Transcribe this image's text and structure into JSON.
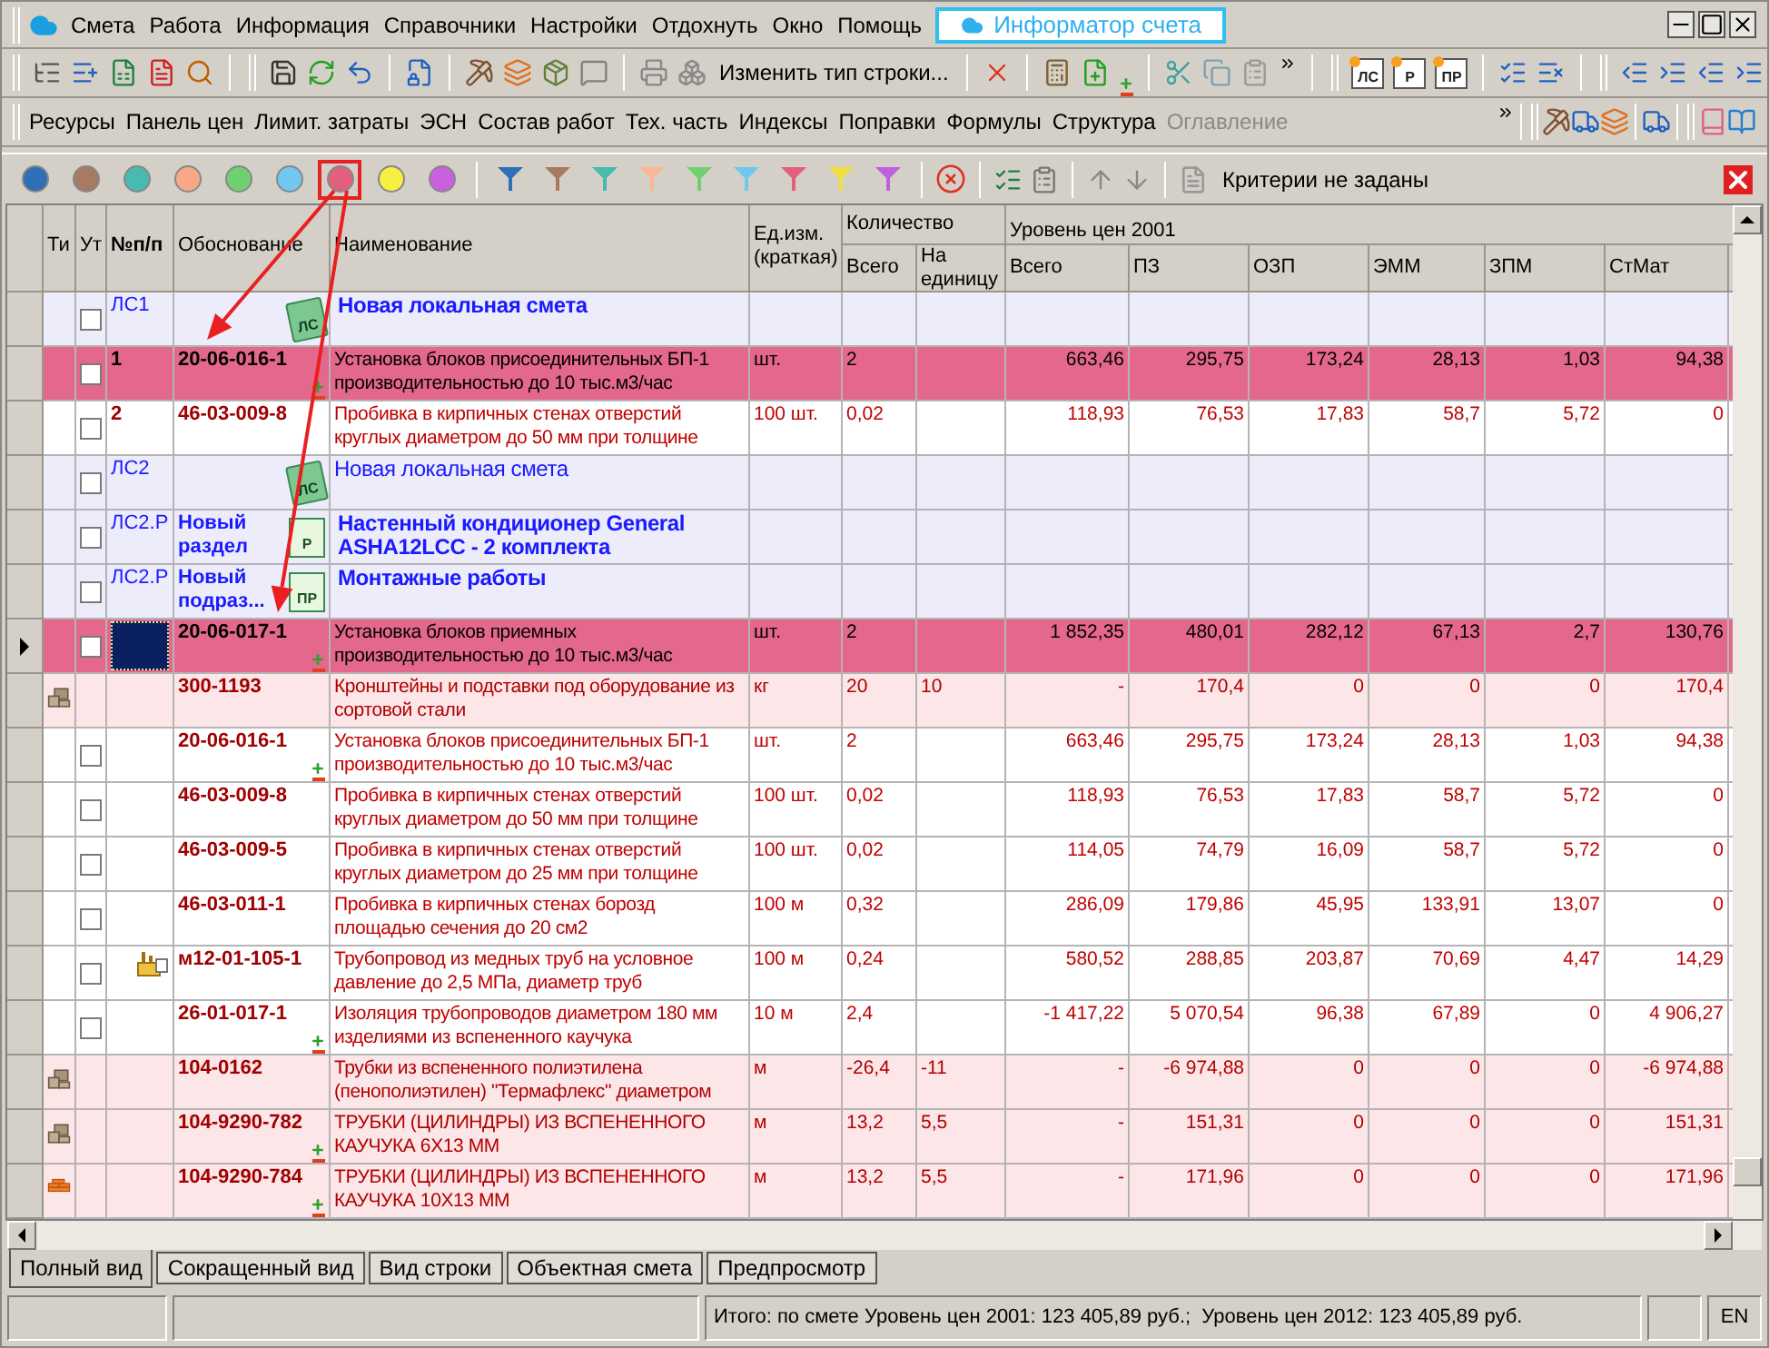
{
  "menu": {
    "items": [
      "Смета",
      "Работа",
      "Информация",
      "Справочники",
      "Настройки",
      "Отдохнуть",
      "Окно",
      "Помощь"
    ],
    "app_tab": "Информатор счета"
  },
  "toolbar": {
    "change_type_button": "Изменить тип строки...",
    "structure_buttons": [
      "ЛС",
      "Р",
      "ПР"
    ]
  },
  "panels": [
    {
      "label": "Ресурсы",
      "disabled": false
    },
    {
      "label": "Панель цен",
      "disabled": false
    },
    {
      "label": "Лимит. затраты",
      "disabled": false
    },
    {
      "label": "ЭСН",
      "disabled": false
    },
    {
      "label": "Состав работ",
      "disabled": false
    },
    {
      "label": "Тех. часть",
      "disabled": false
    },
    {
      "label": "Индексы",
      "disabled": false
    },
    {
      "label": "Поправки",
      "disabled": false
    },
    {
      "label": "Формулы",
      "disabled": false
    },
    {
      "label": "Структура",
      "disabled": false
    },
    {
      "label": "Оглавление",
      "disabled": true
    }
  ],
  "filters": {
    "dots": [
      {
        "color": "#2f6fb8",
        "selected": false
      },
      {
        "color": "#a87a64",
        "selected": false
      },
      {
        "color": "#48bab0",
        "selected": false
      },
      {
        "color": "#f8a888",
        "selected": false
      },
      {
        "color": "#70d070",
        "selected": false
      },
      {
        "color": "#70c8f0",
        "selected": false
      },
      {
        "color": "#e0607e",
        "selected": true
      },
      {
        "color": "#f8f040",
        "selected": false
      },
      {
        "color": "#c860e0",
        "selected": false
      }
    ],
    "funnels": [
      {
        "color": "#2f6fb8"
      },
      {
        "color": "#a87a64"
      },
      {
        "color": "#48bab0"
      },
      {
        "color": "#f8b898"
      },
      {
        "color": "#70d070"
      },
      {
        "color": "#70c8f0"
      },
      {
        "color": "#e0607e"
      },
      {
        "color": "#f0e040"
      },
      {
        "color": "#c060e0"
      }
    ],
    "criteria": "Критерии не заданы"
  },
  "table": {
    "columns": {
      "type": "Ти",
      "deleted": "Ут",
      "number": "№п/п",
      "basis": "Обоснование",
      "name": "Наименование",
      "unit": "Ед.изм. (краткая)",
      "quantity": "Количество",
      "total": "Всего",
      "per_unit": "На единицу",
      "price_level": "Уровень цен 2001",
      "prices": [
        "Всего",
        "ПЗ",
        "ОЗП",
        "ЭММ",
        "ЗПМ",
        "СтМат"
      ]
    },
    "rows": [
      {
        "kind": "section",
        "num": "ЛС1",
        "code": "",
        "name": "Новая локальная смета",
        "bold": true,
        "icon_label": "ЛС",
        "checked": false
      },
      {
        "kind": "position",
        "highlighted": true,
        "current": false,
        "num": "1",
        "code": "20-06-016-1",
        "adjustable": true,
        "name": "Установка блоков присоединительных БП-1 производительностью до 10 тыс.м3/час",
        "unit": "шт.",
        "qty": "2",
        "per_unit": "",
        "values": [
          "663,46",
          "295,75",
          "173,24",
          "28,13",
          "1,03",
          "94,38"
        ],
        "checked": false
      },
      {
        "kind": "position",
        "highlighted": false,
        "current": false,
        "num": "2",
        "code": "46-03-009-8",
        "adjustable": false,
        "name": "Пробивка в кирпичных стенах отверстий круглых диаметром до 50 мм при толщине",
        "unit": "100 шт.",
        "qty": "0,02",
        "per_unit": "",
        "values": [
          "118,93",
          "76,53",
          "17,83",
          "58,7",
          "5,72",
          "0"
        ],
        "checked": false
      },
      {
        "kind": "section",
        "num": "ЛС2",
        "code": "",
        "name": "Новая локальная смета",
        "bold": false,
        "icon_label": "ЛС",
        "checked": false
      },
      {
        "kind": "section",
        "num": "ЛС2.Р",
        "code": "Новый раздел",
        "name": "Настенный кондиционер General ASHA12LCC - 2 комплекта",
        "bold": true,
        "icon_label": "Р",
        "checked": false
      },
      {
        "kind": "section",
        "num": "ЛС2.Р",
        "code": "Новый подраз...",
        "name": "Монтажные работы",
        "bold": true,
        "icon_label": "ПР",
        "checked": false
      },
      {
        "kind": "position",
        "highlighted": true,
        "current": true,
        "num": "",
        "code": "20-06-017-1",
        "adjustable": true,
        "name": "Установка блоков приемных производительностью до 10 тыс.м3/час",
        "unit": "шт.",
        "qty": "2",
        "per_unit": "",
        "values": [
          "1 852,35",
          "480,01",
          "282,12",
          "67,13",
          "2,7",
          "130,76"
        ],
        "checked": false
      },
      {
        "kind": "equipment",
        "code": "300-1193",
        "adjustable": false,
        "name": "Кронштейны и подставки под оборудование из сортовой стали",
        "unit": "кг",
        "qty": "20",
        "per_unit": "10",
        "values": [
          "-",
          "170,4",
          "0",
          "0",
          "0",
          "170,4"
        ]
      },
      {
        "kind": "position",
        "highlighted": false,
        "current": false,
        "num": "",
        "code": "20-06-016-1",
        "adjustable": true,
        "name": "Установка блоков присоединительных БП-1 производительностью до 10 тыс.м3/час",
        "unit": "шт.",
        "qty": "2",
        "per_unit": "",
        "values": [
          "663,46",
          "295,75",
          "173,24",
          "28,13",
          "1,03",
          "94,38"
        ],
        "checked": false
      },
      {
        "kind": "position",
        "highlighted": false,
        "current": false,
        "num": "",
        "code": "46-03-009-8",
        "adjustable": false,
        "name": "Пробивка в кирпичных стенах отверстий круглых диаметром до 50 мм при толщине",
        "unit": "100 шт.",
        "qty": "0,02",
        "per_unit": "",
        "values": [
          "118,93",
          "76,53",
          "17,83",
          "58,7",
          "5,72",
          "0"
        ],
        "checked": false
      },
      {
        "kind": "position",
        "highlighted": false,
        "current": false,
        "num": "",
        "code": "46-03-009-5",
        "adjustable": false,
        "name": "Пробивка в кирпичных стенах отверстий круглых диаметром до 25 мм при толщине",
        "unit": "100 шт.",
        "qty": "0,02",
        "per_unit": "",
        "values": [
          "114,05",
          "74,79",
          "16,09",
          "58,7",
          "5,72",
          "0"
        ],
        "checked": false
      },
      {
        "kind": "position",
        "highlighted": false,
        "current": false,
        "num": "",
        "code": "46-03-011-1",
        "adjustable": false,
        "name": "Пробивка в кирпичных стенах борозд площадью сечения до 20 см2",
        "unit": "100 м",
        "qty": "0,32",
        "per_unit": "",
        "values": [
          "286,09",
          "179,86",
          "45,95",
          "133,91",
          "13,07",
          "0"
        ],
        "checked": false
      },
      {
        "kind": "installation",
        "highlighted": false,
        "current": false,
        "num": "",
        "code": "м12-01-105-1",
        "adjustable": false,
        "name": "Трубопровод из медных труб на условное давление до 2,5 МПа, диаметр труб",
        "unit": "100 м",
        "qty": "0,24",
        "per_unit": "",
        "values": [
          "580,52",
          "288,85",
          "203,87",
          "70,69",
          "4,47",
          "14,29"
        ],
        "checked": false
      },
      {
        "kind": "position",
        "highlighted": false,
        "current": false,
        "num": "",
        "code": "26-01-017-1",
        "adjustable": true,
        "name": "Изоляция трубопроводов диаметром 180 мм изделиями из вспененного каучука",
        "unit": "10 м",
        "qty": "2,4",
        "per_unit": "",
        "values": [
          "-1 417,22",
          "5 070,54",
          "96,38",
          "67,89",
          "0",
          "4 906,27"
        ],
        "checked": false
      },
      {
        "kind": "equipment",
        "code": "104-0162",
        "adjustable": false,
        "name": "Трубки из вспененного полиэтилена (пенополиэтилен) \"Термафлекс\" диаметром",
        "unit": "м",
        "qty": "-26,4",
        "per_unit": "-11",
        "values": [
          "-",
          "-6 974,88",
          "0",
          "0",
          "0",
          "-6 974,88"
        ]
      },
      {
        "kind": "equipment",
        "code": "104-9290-782",
        "adjustable": true,
        "name": "ТРУБКИ (ЦИЛИНДРЫ) ИЗ ВСПЕНЕННОГО КАУЧУКА 6Х13 ММ",
        "unit": "м",
        "qty": "13,2",
        "per_unit": "5,5",
        "values": [
          "-",
          "151,31",
          "0",
          "0",
          "0",
          "151,31"
        ]
      },
      {
        "kind": "material",
        "code": "104-9290-784",
        "adjustable": true,
        "name": "ТРУБКИ (ЦИЛИНДРЫ) ИЗ ВСПЕНЕННОГО КАУЧУКА 10Х13 ММ",
        "unit": "м",
        "qty": "13,2",
        "per_unit": "5,5",
        "values": [
          "-",
          "171,96",
          "0",
          "0",
          "0",
          "171,96"
        ]
      }
    ]
  },
  "view_tabs": [
    {
      "label": "Полный вид",
      "selected": true
    },
    {
      "label": "Сокращенный вид",
      "selected": false
    },
    {
      "label": "Вид строки",
      "selected": false
    },
    {
      "label": "Объектная смета",
      "selected": false
    },
    {
      "label": "Предпросмотр",
      "selected": false
    }
  ],
  "status_bar": {
    "total": "Итого: по смете Уровень цен 2001: 123 405,89 руб.;  Уровень цен 2012: 123 405,89 руб.",
    "language": "EN"
  }
}
